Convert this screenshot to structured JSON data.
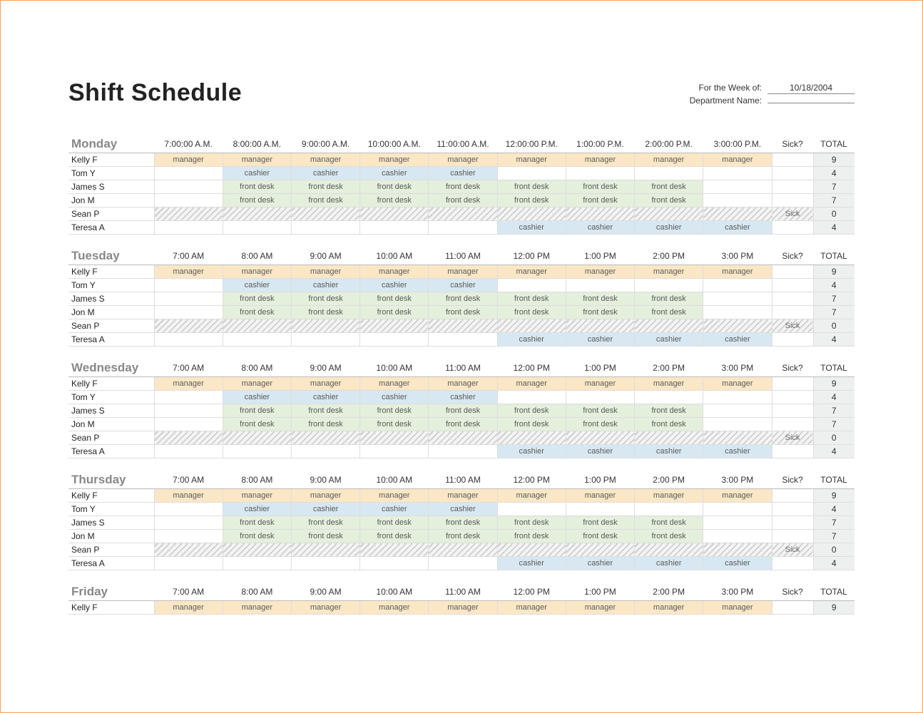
{
  "title": "Shift Schedule",
  "meta": {
    "week_label": "For the Week of:",
    "week_value": "10/18/2004",
    "dept_label": "Department Name:",
    "dept_value": ""
  },
  "sick_header": "Sick?",
  "total_header": "TOTAL",
  "roles": {
    "manager": {
      "label": "manager",
      "class": "manager"
    },
    "cashier": {
      "label": "cashier",
      "class": "cashier"
    },
    "front_desk": {
      "label": "front desk",
      "class": "front_desk"
    }
  },
  "days": [
    {
      "name": "Monday",
      "hours": [
        "7:00:00 A.M.",
        "8:00:00 A.M.",
        "9:00:00 A.M.",
        "10:00:00 A.M.",
        "11:00:00 A.M.",
        "12:00:00 P.M.",
        "1:00:00 P.M.",
        "2:00:00 P.M.",
        "3:00:00 P.M."
      ],
      "rows": [
        {
          "name": "Kelly F",
          "slots": [
            "manager",
            "manager",
            "manager",
            "manager",
            "manager",
            "manager",
            "manager",
            "manager",
            "manager"
          ],
          "sick": "",
          "total": 9
        },
        {
          "name": "Tom Y",
          "slots": [
            "",
            "cashier",
            "cashier",
            "cashier",
            "cashier",
            "",
            "",
            "",
            ""
          ],
          "sick": "",
          "total": 4
        },
        {
          "name": "James S",
          "slots": [
            "",
            "front_desk",
            "front_desk",
            "front_desk",
            "front_desk",
            "front_desk",
            "front_desk",
            "front_desk",
            ""
          ],
          "sick": "",
          "total": 7
        },
        {
          "name": "Jon M",
          "slots": [
            "",
            "front_desk",
            "front_desk",
            "front_desk",
            "front_desk",
            "front_desk",
            "front_desk",
            "front_desk",
            ""
          ],
          "sick": "",
          "total": 7
        },
        {
          "name": "Sean P",
          "slots": [
            "",
            "",
            "",
            "",
            "",
            "",
            "",
            "",
            ""
          ],
          "sick": "Sick",
          "total": 0,
          "hatched": true
        },
        {
          "name": "Teresa A",
          "slots": [
            "",
            "",
            "",
            "",
            "",
            "cashier",
            "cashier",
            "cashier",
            "cashier"
          ],
          "sick": "",
          "total": 4
        }
      ]
    },
    {
      "name": "Tuesday",
      "hours": [
        "7:00 AM",
        "8:00 AM",
        "9:00 AM",
        "10:00 AM",
        "11:00 AM",
        "12:00 PM",
        "1:00 PM",
        "2:00 PM",
        "3:00 PM"
      ],
      "rows": [
        {
          "name": "Kelly F",
          "slots": [
            "manager",
            "manager",
            "manager",
            "manager",
            "manager",
            "manager",
            "manager",
            "manager",
            "manager"
          ],
          "sick": "",
          "total": 9
        },
        {
          "name": "Tom Y",
          "slots": [
            "",
            "cashier",
            "cashier",
            "cashier",
            "cashier",
            "",
            "",
            "",
            ""
          ],
          "sick": "",
          "total": 4
        },
        {
          "name": "James S",
          "slots": [
            "",
            "front_desk",
            "front_desk",
            "front_desk",
            "front_desk",
            "front_desk",
            "front_desk",
            "front_desk",
            ""
          ],
          "sick": "",
          "total": 7
        },
        {
          "name": "Jon M",
          "slots": [
            "",
            "front_desk",
            "front_desk",
            "front_desk",
            "front_desk",
            "front_desk",
            "front_desk",
            "front_desk",
            ""
          ],
          "sick": "",
          "total": 7
        },
        {
          "name": "Sean P",
          "slots": [
            "",
            "",
            "",
            "",
            "",
            "",
            "",
            "",
            ""
          ],
          "sick": "Sick",
          "total": 0,
          "hatched": true
        },
        {
          "name": "Teresa A",
          "slots": [
            "",
            "",
            "",
            "",
            "",
            "cashier",
            "cashier",
            "cashier",
            "cashier"
          ],
          "sick": "",
          "total": 4
        }
      ]
    },
    {
      "name": "Wednesday",
      "hours": [
        "7:00 AM",
        "8:00 AM",
        "9:00 AM",
        "10:00 AM",
        "11:00 AM",
        "12:00 PM",
        "1:00 PM",
        "2:00 PM",
        "3:00 PM"
      ],
      "rows": [
        {
          "name": "Kelly F",
          "slots": [
            "manager",
            "manager",
            "manager",
            "manager",
            "manager",
            "manager",
            "manager",
            "manager",
            "manager"
          ],
          "sick": "",
          "total": 9
        },
        {
          "name": "Tom Y",
          "slots": [
            "",
            "cashier",
            "cashier",
            "cashier",
            "cashier",
            "",
            "",
            "",
            ""
          ],
          "sick": "",
          "total": 4
        },
        {
          "name": "James S",
          "slots": [
            "",
            "front_desk",
            "front_desk",
            "front_desk",
            "front_desk",
            "front_desk",
            "front_desk",
            "front_desk",
            ""
          ],
          "sick": "",
          "total": 7
        },
        {
          "name": "Jon M",
          "slots": [
            "",
            "front_desk",
            "front_desk",
            "front_desk",
            "front_desk",
            "front_desk",
            "front_desk",
            "front_desk",
            ""
          ],
          "sick": "",
          "total": 7
        },
        {
          "name": "Sean P",
          "slots": [
            "",
            "",
            "",
            "",
            "",
            "",
            "",
            "",
            ""
          ],
          "sick": "Sick",
          "total": 0,
          "hatched": true
        },
        {
          "name": "Teresa A",
          "slots": [
            "",
            "",
            "",
            "",
            "",
            "cashier",
            "cashier",
            "cashier",
            "cashier"
          ],
          "sick": "",
          "total": 4
        }
      ]
    },
    {
      "name": "Thursday",
      "hours": [
        "7:00 AM",
        "8:00 AM",
        "9:00 AM",
        "10:00 AM",
        "11:00 AM",
        "12:00 PM",
        "1:00 PM",
        "2:00 PM",
        "3:00 PM"
      ],
      "rows": [
        {
          "name": "Kelly F",
          "slots": [
            "manager",
            "manager",
            "manager",
            "manager",
            "manager",
            "manager",
            "manager",
            "manager",
            "manager"
          ],
          "sick": "",
          "total": 9
        },
        {
          "name": "Tom Y",
          "slots": [
            "",
            "cashier",
            "cashier",
            "cashier",
            "cashier",
            "",
            "",
            "",
            ""
          ],
          "sick": "",
          "total": 4
        },
        {
          "name": "James S",
          "slots": [
            "",
            "front_desk",
            "front_desk",
            "front_desk",
            "front_desk",
            "front_desk",
            "front_desk",
            "front_desk",
            ""
          ],
          "sick": "",
          "total": 7
        },
        {
          "name": "Jon M",
          "slots": [
            "",
            "front_desk",
            "front_desk",
            "front_desk",
            "front_desk",
            "front_desk",
            "front_desk",
            "front_desk",
            ""
          ],
          "sick": "",
          "total": 7
        },
        {
          "name": "Sean P",
          "slots": [
            "",
            "",
            "",
            "",
            "",
            "",
            "",
            "",
            ""
          ],
          "sick": "Sick",
          "total": 0,
          "hatched": true
        },
        {
          "name": "Teresa A",
          "slots": [
            "",
            "",
            "",
            "",
            "",
            "cashier",
            "cashier",
            "cashier",
            "cashier"
          ],
          "sick": "",
          "total": 4
        }
      ]
    },
    {
      "name": "Friday",
      "hours": [
        "7:00 AM",
        "8:00 AM",
        "9:00 AM",
        "10:00 AM",
        "11:00 AM",
        "12:00 PM",
        "1:00 PM",
        "2:00 PM",
        "3:00 PM"
      ],
      "rows": [
        {
          "name": "Kelly F",
          "slots": [
            "manager",
            "manager",
            "manager",
            "manager",
            "manager",
            "manager",
            "manager",
            "manager",
            "manager"
          ],
          "sick": "",
          "total": 9
        }
      ]
    }
  ]
}
